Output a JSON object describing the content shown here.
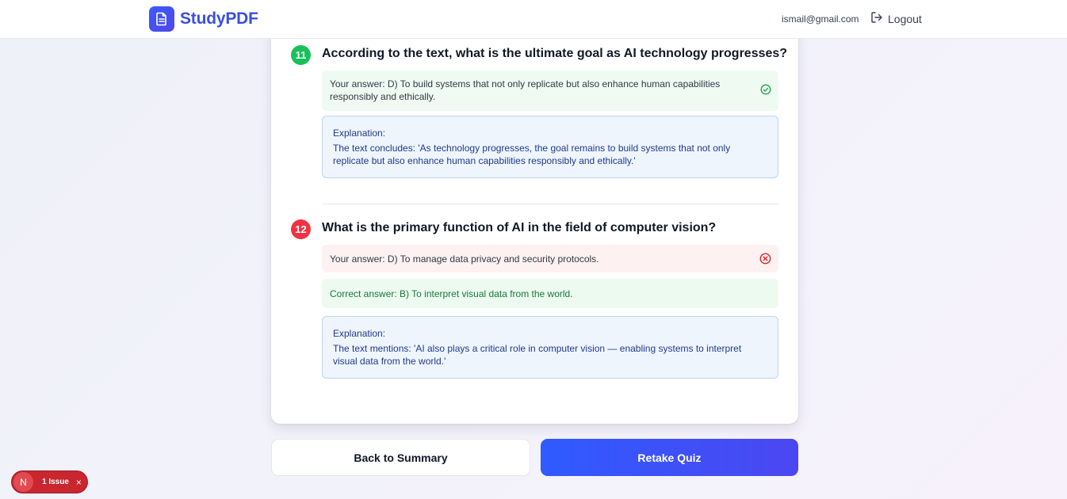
{
  "app": {
    "name": "StudyPDF"
  },
  "header": {
    "user_email": "ismail@gmail.com",
    "logout_label": "Logout"
  },
  "questions": [
    {
      "number": "11",
      "status": "correct",
      "question": "According to the text, what is the ultimate goal as AI technology progresses?",
      "your_answer": "Your answer: D) To build systems that not only replicate but also enhance human capabilities responsibly and ethically.",
      "explanation_label": "Explanation:",
      "explanation": "The text concludes: 'As technology progresses, the goal remains to build systems that not only replicate but also enhance human capabilities responsibly and ethically.'"
    },
    {
      "number": "12",
      "status": "incorrect",
      "question": "What is the primary function of AI in the field of computer vision?",
      "your_answer": "Your answer: D) To manage data privacy and security protocols.",
      "correct_answer": "Correct answer: B) To interpret visual data from the world.",
      "explanation_label": "Explanation:",
      "explanation": "The text mentions: 'AI also plays a critical role in computer vision — enabling systems to interpret visual data from the world.'"
    }
  ],
  "actions": {
    "back_label": "Back to Summary",
    "retake_label": "Retake Quiz"
  },
  "dev_overlay": {
    "badge_letter": "N",
    "issues_label": "1 Issue",
    "close_glyph": "×"
  },
  "colors": {
    "brand": "#3b4fe0",
    "correct": "#16c15a",
    "incorrect": "#ef3342"
  },
  "icons": [
    "document-icon",
    "logout-icon",
    "check-circle-icon",
    "x-circle-icon"
  ]
}
